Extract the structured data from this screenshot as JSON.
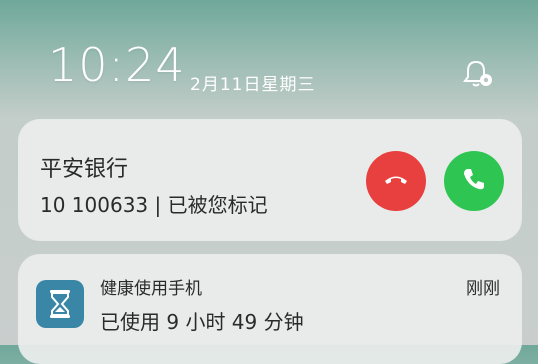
{
  "lockscreen": {
    "time": "10:24",
    "date": "2月11日星期三"
  },
  "icons": {
    "settings": "notification-settings-icon",
    "decline": "phone-hangup-icon",
    "accept": "phone-answer-icon",
    "app": "hourglass-icon"
  },
  "call": {
    "caller_name": "平安银行",
    "caller_info": "10 100633 | 已被您标记"
  },
  "notification": {
    "app_name": "健康使用手机",
    "time": "刚刚",
    "body": "已使用 9 小时 49 分钟"
  },
  "colors": {
    "decline": "#e8403f",
    "accept": "#2fc553",
    "app_icon": "#3a86a6"
  }
}
